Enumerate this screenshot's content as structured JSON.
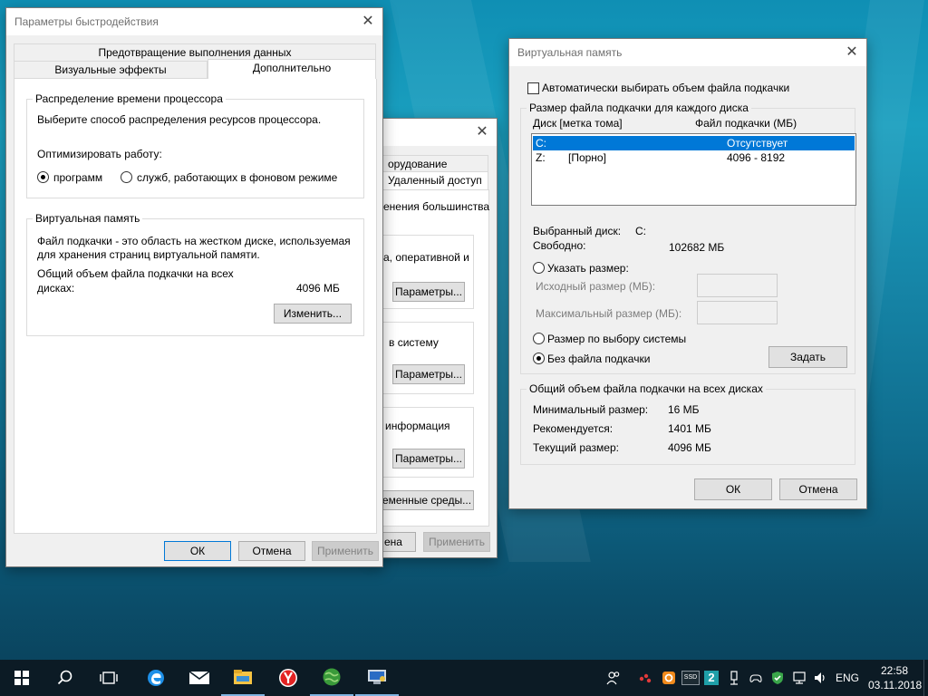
{
  "perf_window": {
    "title": "Параметры быстродействия",
    "tabs": {
      "data_prevention": "Предотвращение выполнения данных",
      "visual_effects": "Визуальные эффекты",
      "advanced": "Дополнительно"
    },
    "cpu_group": {
      "title": "Распределение времени процессора",
      "description": "Выберите способ распределения ресурсов процессора.",
      "optimize_label": "Оптимизировать работу:",
      "programs": "программ",
      "services": "служб, работающих в фоновом режиме"
    },
    "vm_group": {
      "title": "Виртуальная память",
      "description_line1": "Файл подкачки - это область на жестком диске, используемая",
      "description_line2": "для хранения страниц виртуальной памяти.",
      "total_label_line1": "Общий объем файла подкачки на всех",
      "total_label_line2": "дисках:",
      "total_value": "4096 МБ",
      "change_button": "Изменить..."
    },
    "ok_button": "ОК",
    "cancel_button": "Отмена",
    "apply_button": "Применить"
  },
  "sysprops_window": {
    "tab_hardware": "орудование",
    "tab_remote": "Удаленный доступ",
    "text_most_changes": "енения большинства",
    "text_performance": "а, оперативной и",
    "text_profiles": "в систему",
    "text_startup": "информация",
    "params_button": "Параметры...",
    "env_button": "еменные среды...",
    "cancel_fragment": "ена",
    "apply_button": "Применить"
  },
  "vm_window": {
    "title": "Виртуальная память",
    "auto_checkbox": "Автоматически выбирать объем файла подкачки",
    "per_disk_group": "Размер файла подкачки для каждого диска",
    "col_disk": "Диск [метка тома]",
    "col_pagefile": "Файл подкачки (МБ)",
    "drives": [
      {
        "letter": "C:",
        "label": "",
        "size": "Отсутствует"
      },
      {
        "letter": "Z:",
        "label": "[Порно]",
        "size": "4096 - 8192"
      }
    ],
    "selected_disk_label": "Выбранный диск:",
    "selected_disk_value": "C:",
    "free_label": "Свободно:",
    "free_value": "102682 МБ",
    "custom_size": "Указать размер:",
    "initial_size": "Исходный размер (МБ):",
    "max_size": "Максимальный размер (МБ):",
    "system_managed": "Размер по выбору системы",
    "no_pagefile": "Без файла подкачки",
    "set_button": "Задать",
    "total_group": "Общий объем файла подкачки на всех дисках",
    "min_label": "Минимальный размер:",
    "min_value": "16 МБ",
    "recommended_label": "Рекомендуется:",
    "recommended_value": "1401 МБ",
    "current_label": "Текущий размер:",
    "current_value": "4096 МБ",
    "ok_button": "ОК",
    "cancel_button": "Отмена"
  },
  "taskbar": {
    "language": "ENG",
    "time": "22:58",
    "date": "03.11.2018",
    "tray_ssd": "SSD",
    "tray_two": "2"
  },
  "colors": {
    "selection": "#0078d7",
    "taskbar": "#0c1b25",
    "window_bg": "#f0f0f0"
  }
}
